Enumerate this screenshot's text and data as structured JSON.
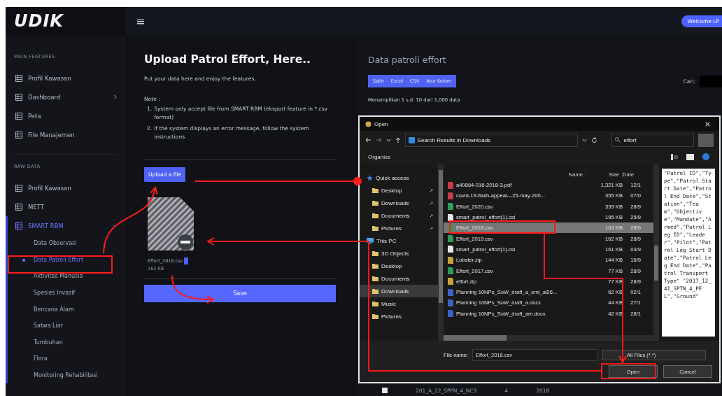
{
  "topbar": {
    "logo": "UDIK",
    "menu_glyph": "≡",
    "user_button": "Welcome LP"
  },
  "sidebar": {
    "sections": [
      {
        "heading": "MAIN FEATURES",
        "items": [
          {
            "label": "Profil Kawasan",
            "selected": false
          },
          {
            "label": "Dashboard",
            "selected": false,
            "expanded": false
          },
          {
            "label": "Peta",
            "selected": false
          },
          {
            "label": "File Manajemen",
            "selected": false
          }
        ]
      },
      {
        "heading": "RAW DATA",
        "items": [
          {
            "label": "Profil Kawasan",
            "selected": false
          },
          {
            "label": "METT",
            "selected": false
          },
          {
            "label": "SMART RBM",
            "selected": true,
            "expanded": true,
            "children": [
              {
                "label": "Data Observasi",
                "selected": false
              },
              {
                "label": "Data Patroli Effort",
                "selected": true
              },
              {
                "label": "Aktivitas Manusia",
                "selected": false
              },
              {
                "label": "Spesies Invasif",
                "selected": false
              },
              {
                "label": "Bencana Alam",
                "selected": false
              },
              {
                "label": "Satwa Liar",
                "selected": false
              },
              {
                "label": "Tumbuhan",
                "selected": false
              },
              {
                "label": "Flora",
                "selected": false
              },
              {
                "label": "Monitoring Rehabilitasi",
                "selected": false
              }
            ]
          }
        ]
      }
    ]
  },
  "upload": {
    "title": "Upload Patrol Effort, Here..",
    "subtitle": "Put your data here and enjoy the features.",
    "note_heading": "Note :",
    "notes": [
      {
        "number": "1.",
        "text": "System only accept file from SMART RBM (eksport feature in *.csv format)"
      },
      {
        "number": "2.",
        "text": "If the system displays an error message, follow the system instructions"
      }
    ],
    "upload_button": "Upload a file",
    "file": {
      "name": "Effort_2018.csv",
      "size": "163 KB"
    },
    "save_button": "Save"
  },
  "data_panel": {
    "title": "Data patroli effort",
    "export_buttons": [
      "Salin",
      "Excel",
      "CSV",
      "Atur Kolom"
    ],
    "search_label": "Cari:",
    "summary": "Menampilkan 1 s.d. 10 dari 1,000 data",
    "rows": [
      {
        "checked": false,
        "cells": [
          "201_A_22_SPFN_4_NC3",
          "4",
          "2018"
        ]
      }
    ]
  },
  "open_dialog": {
    "title": "Open",
    "close_glyph": "×",
    "path": "Search Results in Downloads",
    "search": "effort",
    "organize": "Organize",
    "nav": [
      {
        "label": "Quick access",
        "kind": "quick-access",
        "selected": false,
        "children": [
          {
            "label": "Desktop",
            "kind": "folder",
            "selected": false,
            "pinned": true
          },
          {
            "label": "Downloads",
            "kind": "folder",
            "selected": false,
            "pinned": true
          },
          {
            "label": "Documents",
            "kind": "folder",
            "selected": false,
            "pinned": true
          },
          {
            "label": "Pictures",
            "kind": "folder",
            "selected": false,
            "pinned": true
          }
        ]
      },
      {
        "label": "This PC",
        "kind": "this-pc",
        "selected": false,
        "children": [
          {
            "label": "3D Objects",
            "kind": "folder",
            "selected": false,
            "pinned": false
          },
          {
            "label": "Desktop",
            "kind": "folder",
            "selected": false,
            "pinned": false
          },
          {
            "label": "Documents",
            "kind": "folder",
            "selected": false,
            "pinned": false
          },
          {
            "label": "Downloads",
            "kind": "folder",
            "selected": true,
            "pinned": false
          },
          {
            "label": "Music",
            "kind": "folder",
            "selected": false,
            "pinned": false
          },
          {
            "label": "Pictures",
            "kind": "folder",
            "selected": false,
            "pinned": false
          }
        ]
      }
    ],
    "columns": [
      "Name",
      "Size",
      "Date"
    ],
    "files": [
      {
        "name": "a40864-016-2018-3.pdf",
        "size": "1,321 KB",
        "date": "12/1",
        "kind": "pdf",
        "selected": false
      },
      {
        "name": "covid-19-flash-appeal---25-may-200...",
        "size": "355 KB",
        "date": "07/0",
        "kind": "pdf",
        "selected": false
      },
      {
        "name": "Effort_2020.csv",
        "size": "339 KB",
        "date": "28/9",
        "kind": "csv",
        "selected": false
      },
      {
        "name": "smart_patrol_effort(1).csl",
        "size": "195 KB",
        "date": "25/9",
        "kind": "text",
        "selected": false
      },
      {
        "name": "Effort_2018.csv",
        "size": "163 KB",
        "date": "28/9",
        "kind": "csv",
        "selected": true
      },
      {
        "name": "Effort_2019.csv",
        "size": "162 KB",
        "date": "28/9",
        "kind": "csv",
        "selected": false
      },
      {
        "name": "smart_patrol_effort(1).csl",
        "size": "161 KB",
        "date": "03/9",
        "kind": "text",
        "selected": false
      },
      {
        "name": "Lobster.zip",
        "size": "144 KB",
        "date": "16/9",
        "kind": "zip",
        "selected": false
      },
      {
        "name": "Effort_2017.csv",
        "size": "77 KB",
        "date": "28/9",
        "kind": "csv",
        "selected": false
      },
      {
        "name": "effort.zip",
        "size": "77 KB",
        "date": "28/9",
        "kind": "zip",
        "selected": false
      },
      {
        "name": "Planning 10NPs_SoW_draft_a_emi_al26...",
        "size": "62 KB",
        "date": "02/1",
        "kind": "doc",
        "selected": false
      },
      {
        "name": "Planning 10NPs_SoW_draft_a.docx",
        "size": "44 KB",
        "date": "27/1",
        "kind": "doc",
        "selected": false
      },
      {
        "name": "Planning 10NPs_SoW_draft_am.docx",
        "size": "42 KB",
        "date": "28/1",
        "kind": "doc",
        "selected": false
      }
    ],
    "preview": "\"Patrol ID\",\"Type\",\"Patrol Start Date\",\"Patrol End Date\",\"Station\",\"Team\",\"Objective\",\"Mandate\",\"Armed\",\"Patrol Leg ID\",\"Leader\",\"Pilot\",\"Patrol Leg Start Date\",\"Patrol Leg End Date\",\"Patrol Transport Type\" \"2017_12_41_SPTN_4_PEL\",\"Ground\"",
    "file_name_label": "File name:",
    "file_name": "Effort_2018.csv",
    "filter": "All Files (*.*)",
    "open_button": "Open",
    "cancel_button": "Cancel"
  }
}
